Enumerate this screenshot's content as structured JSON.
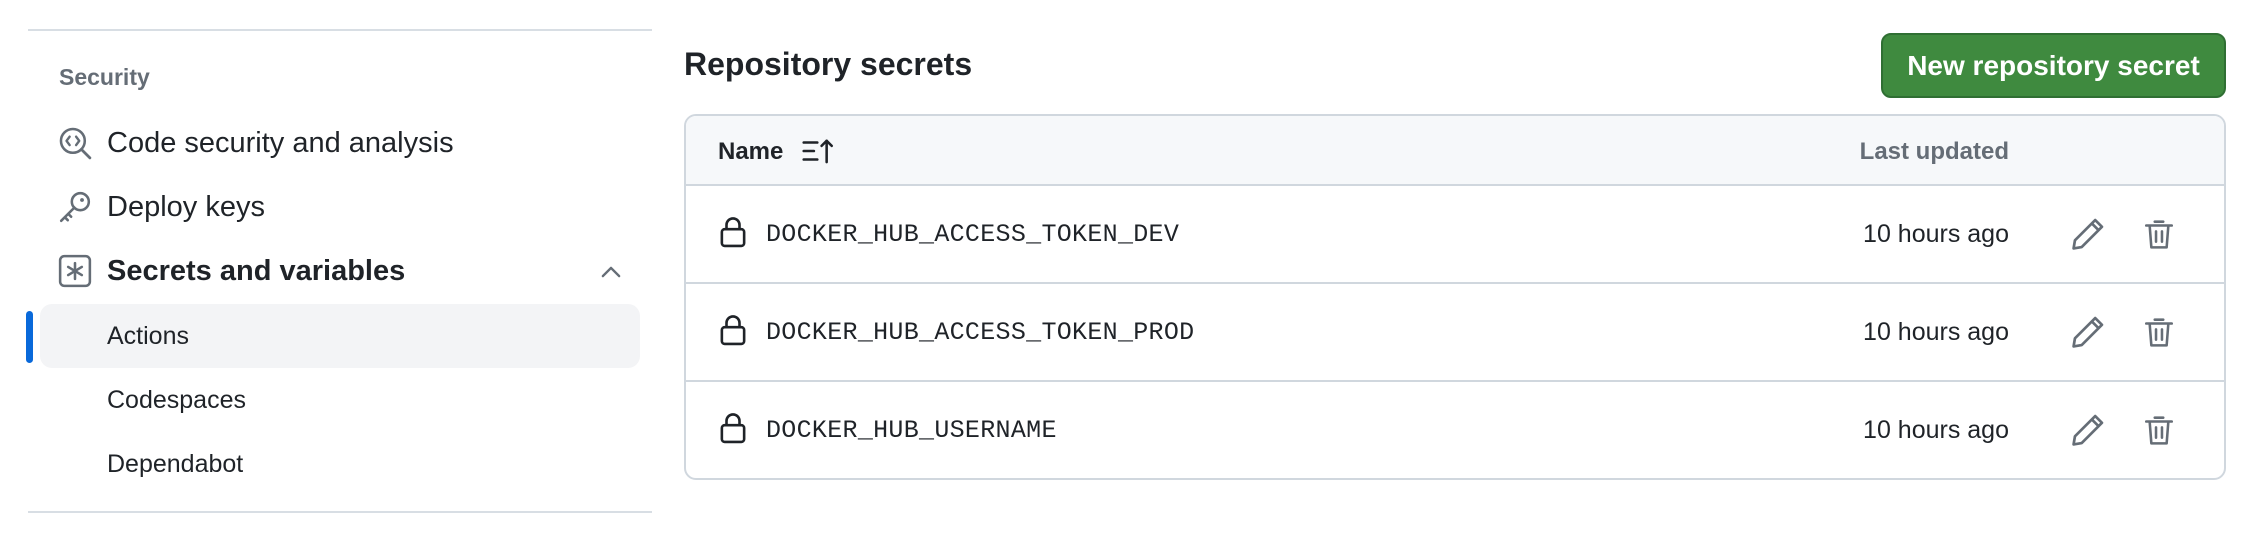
{
  "sidebar": {
    "section_title": "Security",
    "items": [
      {
        "label": "Code security and analysis",
        "icon": "codescan-icon"
      },
      {
        "label": "Deploy keys",
        "icon": "key-icon"
      },
      {
        "label": "Secrets and variables",
        "icon": "asterisk-icon",
        "expanded": true
      }
    ],
    "sub_items": [
      {
        "label": "Actions",
        "active": true
      },
      {
        "label": "Codespaces",
        "active": false
      },
      {
        "label": "Dependabot",
        "active": false
      }
    ]
  },
  "main": {
    "title": "Repository secrets",
    "new_button_label": "New repository secret",
    "table": {
      "col_name": "Name",
      "col_updated": "Last updated",
      "rows": [
        {
          "name": "DOCKER_HUB_ACCESS_TOKEN_DEV",
          "updated": "10 hours ago"
        },
        {
          "name": "DOCKER_HUB_ACCESS_TOKEN_PROD",
          "updated": "10 hours ago"
        },
        {
          "name": "DOCKER_HUB_USERNAME",
          "updated": "10 hours ago"
        }
      ]
    }
  },
  "colors": {
    "accent": "#0969da",
    "button_green": "#3f8a3f",
    "muted_text": "#656d76",
    "border": "#d0d7de"
  }
}
